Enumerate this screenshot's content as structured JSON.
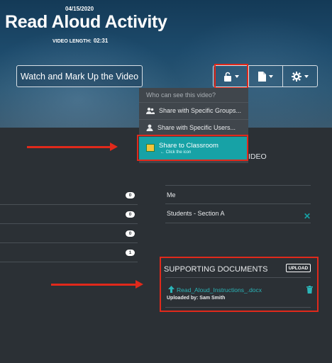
{
  "header": {
    "date": "04/15/2020",
    "title": "Read Aloud Activity",
    "video_length_label": "VIDEO LENGTH:",
    "video_length_value": "02:31"
  },
  "toolbar": {
    "watch_label": "Watch and Mark Up the Video",
    "lock_icon": "lock-icon",
    "document_icon": "document-icon",
    "gear_icon": "gear-icon"
  },
  "share_menu": {
    "heading": "Who can see this video?",
    "items": [
      {
        "label": "Share with Specific Groups...",
        "icon": "group-icon"
      },
      {
        "label": "Share with Specific Users...",
        "icon": "user-icon"
      }
    ],
    "classroom": {
      "label": "Share to Classroom",
      "hint": "← Click the icon",
      "icon": "google-classroom-icon"
    }
  },
  "shared_with": {
    "heading_fragment": "IDEO",
    "rows": [
      {
        "label": "Me"
      },
      {
        "label": "Students - Section A"
      }
    ],
    "remove_symbol": "✕"
  },
  "left_list": {
    "counts": [
      "0",
      "0",
      "0",
      "1"
    ]
  },
  "supporting_documents": {
    "title": "SUPPORTING DOCUMENTS",
    "upload_label": "UPLOAD",
    "file_name": "Read_Aloud_Instructions_.docx",
    "uploaded_by": "Uploaded by: Sam Smith"
  },
  "colors": {
    "accent": "#17a2a6",
    "highlight": "#e0291b",
    "panel": "#2b3035"
  }
}
